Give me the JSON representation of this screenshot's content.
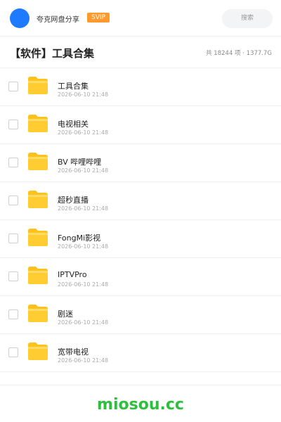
{
  "topbar": {
    "app_title": "夸克网盘分享",
    "badge": "SVIP",
    "search_placeholder": "搜索"
  },
  "header": {
    "title": "【软件】工具合集",
    "summary": "共 18244 项 · 1377.7G"
  },
  "files": [
    {
      "name": "工具合集",
      "date": "2026-06-10 21:48"
    },
    {
      "name": "电视相关",
      "date": "2026-06-10 21:48"
    },
    {
      "name": "BV 哔哩哔哩",
      "date": "2026-06-10 21:48"
    },
    {
      "name": "超秒直播",
      "date": "2026-06-10 21:48"
    },
    {
      "name": "FongMi影视",
      "date": "2026-06-10 21:48"
    },
    {
      "name": "IPTVPro",
      "date": "2026-06-10 21:48"
    },
    {
      "name": "剧迷",
      "date": "2026-06-10 21:48"
    },
    {
      "name": "宽带电视",
      "date": "2026-06-10 21:48"
    }
  ],
  "footer": {
    "watermark": "miosou.cc"
  },
  "colors": {
    "avatar": "#1e7bff",
    "badge": "#ff9a2e",
    "folder": "#ffc21a",
    "watermark": "#2fbf3f"
  },
  "icons": {
    "folder": "folder-icon",
    "avatar": "avatar"
  }
}
